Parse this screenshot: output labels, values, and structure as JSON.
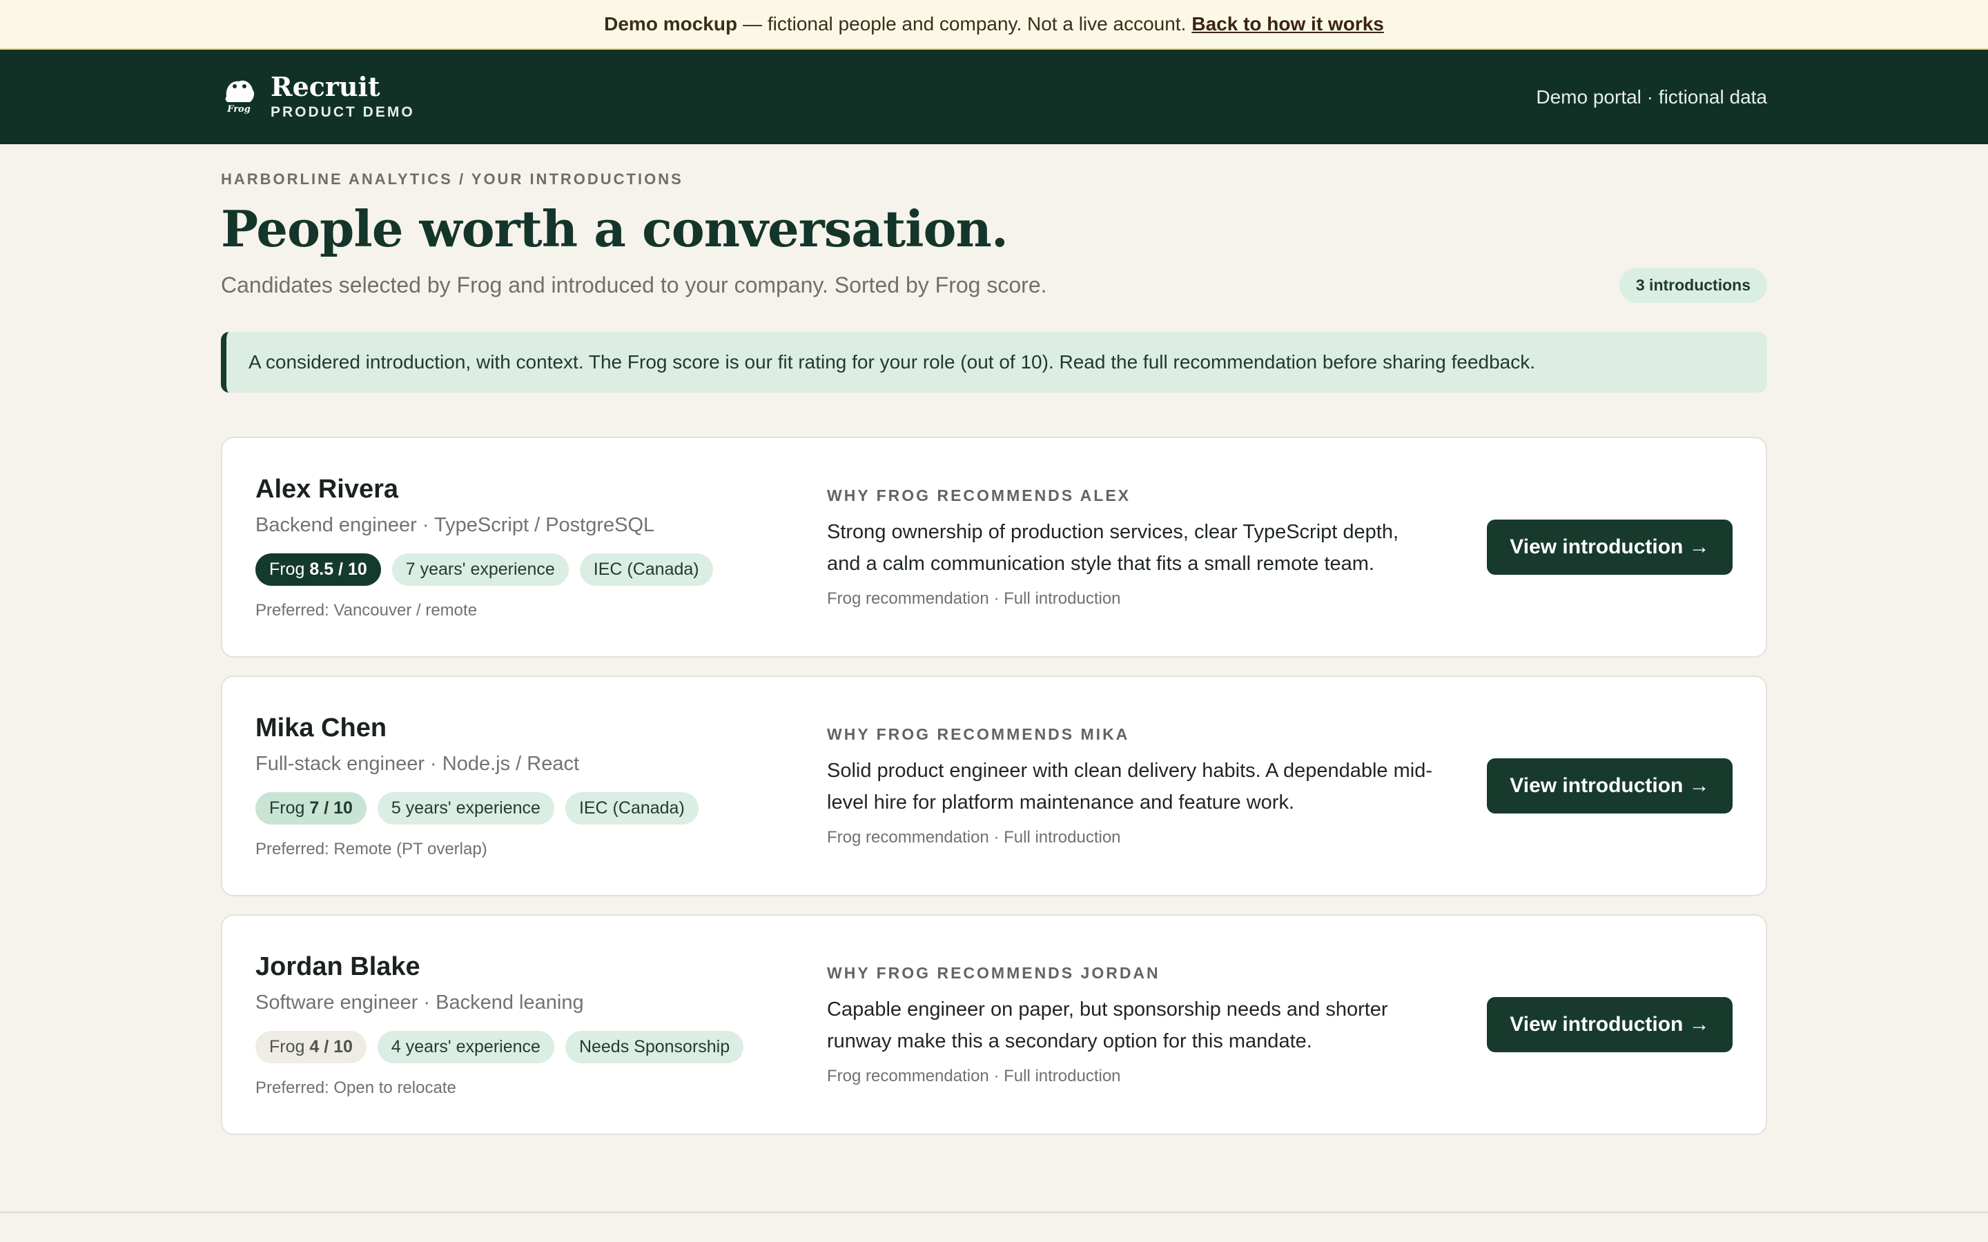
{
  "banner": {
    "strong": "Demo mockup",
    "text": "— fictional people and company. Not a live account.",
    "link": "Back to how it works"
  },
  "header": {
    "brand_name": "Recruit",
    "brand_sub": "PRODUCT DEMO",
    "logo_mark": "Frog",
    "right_text": "Demo portal · fictional data"
  },
  "page": {
    "breadcrumb": "HARBORLINE ANALYTICS / YOUR INTRODUCTIONS",
    "title": "People worth a conversation.",
    "subtitle": "Candidates selected by Frog and introduced to your company. Sorted by Frog score.",
    "count_badge": "3 introductions",
    "callout": "A considered introduction, with context. The Frog score is our fit rating for your role (out of 10). Read the full recommendation before sharing feedback."
  },
  "candidates": [
    {
      "name": "Alex Rivera",
      "role": "Backend engineer · TypeScript / PostgreSQL",
      "score_label": "Frog",
      "score": "8.5 / 10",
      "experience": "7 years' experience",
      "status": "IEC (Canada)",
      "preferred": "Preferred: Vancouver / remote",
      "why_label": "WHY FROG RECOMMENDS ALEX",
      "why_text": "Strong ownership of production services, clear TypeScript depth, and a calm communication style that fits a small remote team.",
      "meta": "Frog recommendation · Full introduction",
      "button": "View introduction →"
    },
    {
      "name": "Mika Chen",
      "role": "Full-stack engineer · Node.js / React",
      "score_label": "Frog",
      "score": "7 / 10",
      "experience": "5 years' experience",
      "status": "IEC (Canada)",
      "preferred": "Preferred: Remote (PT overlap)",
      "why_label": "WHY FROG RECOMMENDS MIKA",
      "why_text": "Solid product engineer with clean delivery habits. A dependable mid-level hire for platform maintenance and feature work.",
      "meta": "Frog recommendation · Full introduction",
      "button": "View introduction →"
    },
    {
      "name": "Jordan Blake",
      "role": "Software engineer · Backend leaning",
      "score_label": "Frog",
      "score": "4 / 10",
      "experience": "4 years' experience",
      "status": "Needs Sponsorship",
      "preferred": "Preferred: Open to relocate",
      "why_label": "WHY FROG RECOMMENDS JORDAN",
      "why_text": "Capable engineer on paper, but sponsorship needs and shorter runway make this a secondary option for this mandate.",
      "meta": "Frog recommendation · Full introduction",
      "button": "View introduction →"
    }
  ],
  "colors": {
    "header_bg": "#113126",
    "accent": "#173a2d",
    "chip_bg": "#dcede3",
    "page_bg": "#f6f3ec"
  },
  "icons": {
    "logo": "frog-logo-icon"
  }
}
